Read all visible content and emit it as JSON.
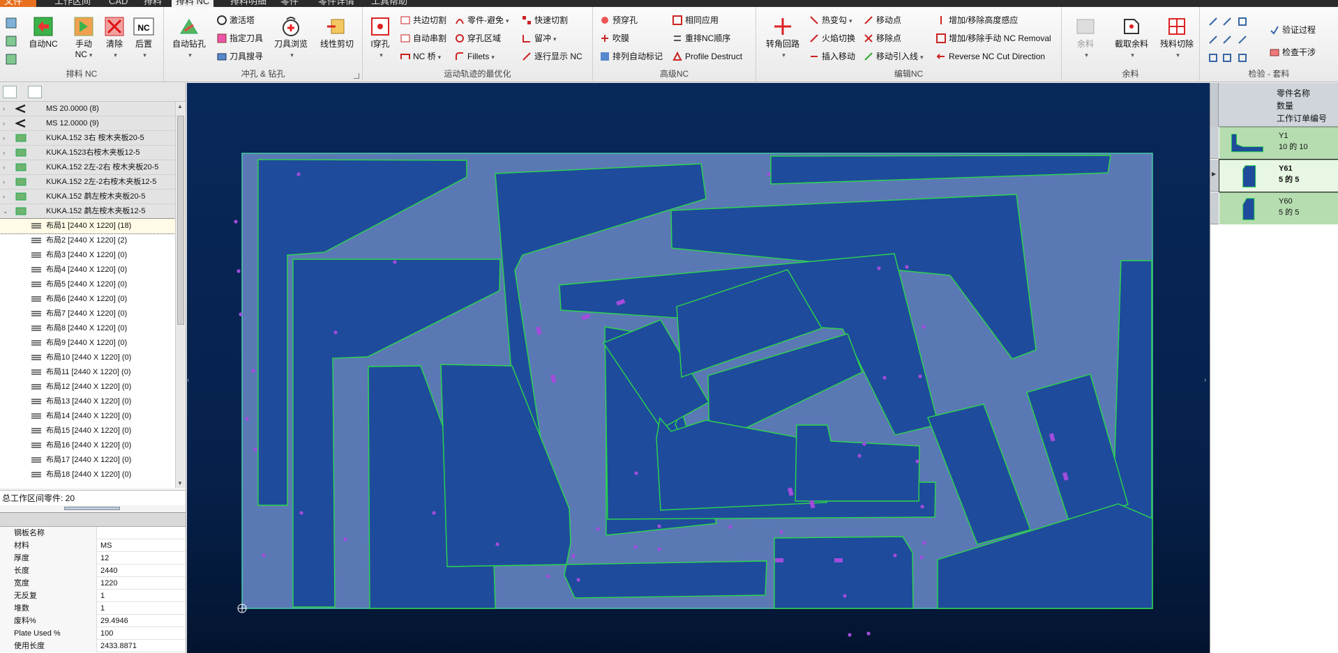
{
  "tabs": [
    "文件",
    "工作区间",
    "CAD",
    "排料",
    "排料 NC",
    "排料明细",
    "零件",
    "零件详情",
    "工具帮助"
  ],
  "ribbon": {
    "groups": [
      "排料 NC",
      "冲孔 & 钻孔",
      "运动轨迹的最优化",
      "高级NC",
      "编辑NC",
      "余料",
      "检验 - 套料"
    ],
    "auto_nc": "自动NC",
    "manual_nc": "手动",
    "manual_nc2": "NC",
    "clear": "清除",
    "post": "后置",
    "auto_drill": "自动钻孔",
    "activate_tower": "激活塔",
    "assign_tool": "指定刀具",
    "tool_search": "刀具搜寻",
    "tool_browse": "刀具浏览",
    "linear_cut": "线性剪切",
    "pierce": "I穿孔",
    "common_cut": "共边切割",
    "auto_series": "自动串割",
    "nc_bridge": "NC 桥",
    "part_avoid": "零件-避免",
    "pierce_area": "穿孔区域",
    "fillets": "Fillets",
    "quick_cut": "快速切割",
    "leave": "留冲",
    "step_display": "逐行显示 NC",
    "pre_pierce": "预穿孔",
    "blow": "吹膜",
    "auto_mark": "排列自动标记",
    "same_apply": "相同应用",
    "rearrange": "重排NC顺序",
    "profile_destruct": "Profile Destruct",
    "corner_loop": "转角回路",
    "hot_change": "热变勾",
    "flame_cut": "火焰切换",
    "insert_move": "插入移动",
    "move_point": "移动点",
    "remove_point": "移除点",
    "move_leadin": "移动引入线",
    "height_sense": "增加/移除高度感应",
    "manual_removal": "增加/移除手动 NC Removal",
    "reverse_nc": "Reverse NC Cut Direction",
    "remnant": "余料",
    "cut_remnant": "截取余料",
    "remnant_cut": "残料切除",
    "verify": "验证过程",
    "check_interfere": "检查干涉"
  },
  "tree": {
    "items": [
      {
        "label": "MS 20.0000 (8)",
        "level": 0
      },
      {
        "label": "MS 12.0000 (9)",
        "level": 0
      },
      {
        "label": "KUKA.152 3右 桉木夹板20-5",
        "level": 0
      },
      {
        "label": "KUKA.1523右桉木夹板12-5",
        "level": 0
      },
      {
        "label": "KUKA.152 2左-2右 桉木夹板20-5",
        "level": 0
      },
      {
        "label": "KUKA.152 2左-2右桉木夹板12-5",
        "level": 0
      },
      {
        "label": "KUKA.152 鹔左桉木夹板20-5",
        "level": 0
      },
      {
        "label": "KUKA.152 鹔左桉木夹板12-5",
        "level": 0,
        "expanded": true
      },
      {
        "label": "布局1 [2440 X 1220]  (18)",
        "level": 1,
        "selected": true
      },
      {
        "label": "布局2 [2440 X 1220]  (2)",
        "level": 1
      },
      {
        "label": "布局3 [2440 X 1220]  (0)",
        "level": 1
      },
      {
        "label": "布局4 [2440 X 1220]  (0)",
        "level": 1
      },
      {
        "label": "布局5 [2440 X 1220]  (0)",
        "level": 1
      },
      {
        "label": "布局6 [2440 X 1220]  (0)",
        "level": 1
      },
      {
        "label": "布局7 [2440 X 1220]  (0)",
        "level": 1
      },
      {
        "label": "布局8 [2440 X 1220]  (0)",
        "level": 1
      },
      {
        "label": "布局9 [2440 X 1220]  (0)",
        "level": 1
      },
      {
        "label": "布局10 [2440 X 1220]  (0)",
        "level": 1
      },
      {
        "label": "布局11 [2440 X 1220]  (0)",
        "level": 1
      },
      {
        "label": "布局12 [2440 X 1220]  (0)",
        "level": 1
      },
      {
        "label": "布局13 [2440 X 1220]  (0)",
        "level": 1
      },
      {
        "label": "布局14 [2440 X 1220]  (0)",
        "level": 1
      },
      {
        "label": "布局15 [2440 X 1220]  (0)",
        "level": 1
      },
      {
        "label": "布局16 [2440 X 1220]  (0)",
        "level": 1
      },
      {
        "label": "布局17 [2440 X 1220]  (0)",
        "level": 1
      },
      {
        "label": "布局18 [2440 X 1220]  (0)",
        "level": 1
      }
    ]
  },
  "total_parts": "总工作区间零件: 20",
  "props": {
    "header": "钢板名称",
    "rows": [
      {
        "k": "材料",
        "v": "MS"
      },
      {
        "k": "厚度",
        "v": "12"
      },
      {
        "k": "长度",
        "v": "2440"
      },
      {
        "k": "宽度",
        "v": "1220"
      },
      {
        "k": "无反复",
        "v": "1"
      },
      {
        "k": "堆数",
        "v": "1"
      },
      {
        "k": "废料%",
        "v": "29.4946"
      },
      {
        "k": "Plate Used %",
        "v": "100"
      },
      {
        "k": "使用长度",
        "v": "2433.8871"
      }
    ]
  },
  "right": {
    "h1": "零件名称",
    "h2": "数量",
    "h3": "工作订单编号",
    "parts": [
      {
        "name": "Y1",
        "qty": "10 的 10"
      },
      {
        "name": "Y61",
        "qty": "5 的 5"
      },
      {
        "name": "Y60",
        "qty": "5 的 5"
      }
    ]
  },
  "colors": {
    "plate": "#5a79b4",
    "part": "#1f4b9c",
    "outline": "#2bd84a",
    "marker": "#a24cdc"
  }
}
